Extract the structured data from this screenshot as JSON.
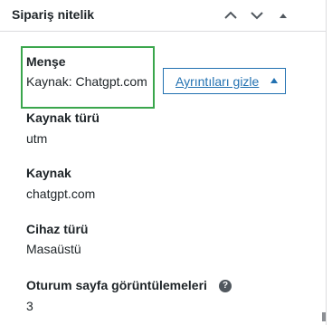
{
  "panel": {
    "title": "Sipariş nitelik"
  },
  "header_buttons": {
    "move_up_icon": "chevron-up-icon",
    "move_down_icon": "chevron-down-icon",
    "toggle_icon": "triangle-up-icon"
  },
  "origin": {
    "label": "Menşe",
    "value": "Kaynak: Chatgpt.com",
    "details_button": "Ayrıntıları gizle"
  },
  "fields": {
    "source_type": {
      "label": "Kaynak türü",
      "value": "utm"
    },
    "source": {
      "label": "Kaynak",
      "value": "chatgpt.com"
    },
    "device_type": {
      "label": "Cihaz türü",
      "value": "Masaüstü"
    },
    "session_page_views": {
      "label": "Oturum sayfa görüntülemeleri",
      "value": "3",
      "help_icon": "?"
    }
  },
  "colors": {
    "highlight_border": "#3aa64c",
    "link": "#2271b1",
    "text": "#1d2327",
    "divider": "#dcdcde"
  }
}
